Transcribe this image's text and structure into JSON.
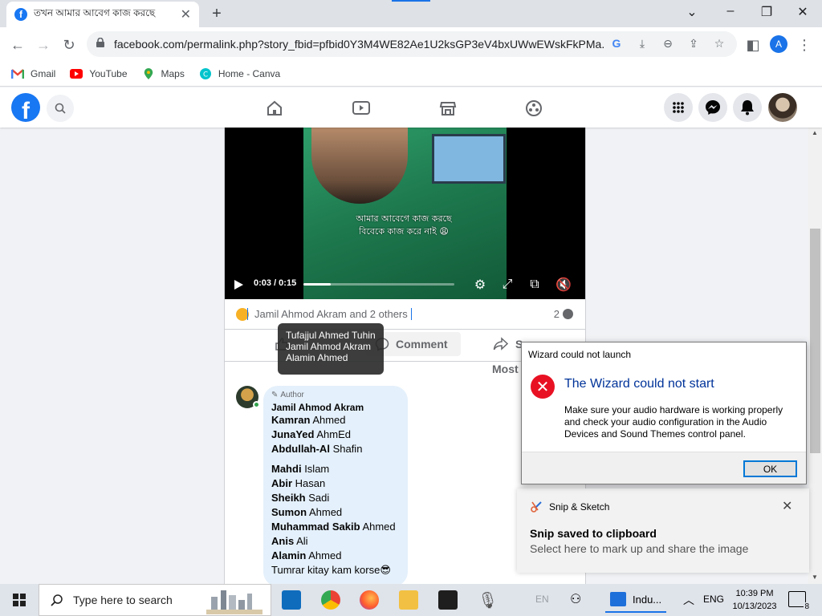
{
  "browser": {
    "tab_title": "তখন আমার আবেগ কাজ করছে",
    "url": "facebook.com/permalink.php?story_fbid=pfbid0Y3M4WE82Ae1U2ksGP3eV4bxUWwEWskFkPMa...",
    "profile_letter": "A",
    "bookmarks": [
      {
        "label": "Gmail",
        "icon": "gmail-icon"
      },
      {
        "label": "YouTube",
        "icon": "youtube-icon"
      },
      {
        "label": "Maps",
        "icon": "maps-icon"
      },
      {
        "label": "Home - Canva",
        "icon": "canva-icon"
      }
    ]
  },
  "video": {
    "caption_line1": "আমার আবেগে কাজ করছে",
    "caption_line2": "বিবেকে কাজ করে নাই 😩",
    "time": "0:03 / 0:15",
    "progress": 0.18
  },
  "reactions": {
    "names": "Jamil Ahmod Akram and 2 others",
    "comment_count": "2"
  },
  "actions": {
    "comment": "Comment",
    "share": "S",
    "sort": "Most"
  },
  "tooltip": {
    "lines": [
      "Tufajjul Ahmed Tuhin",
      "Jamil Ahmod Akram",
      "Alamin Ahmed"
    ]
  },
  "comment": {
    "badge": "Author",
    "author": "Jamil Ahmod Akram",
    "lines_a": [
      {
        "first": "Kamran",
        "last": "Ahmed"
      },
      {
        "first": "JunaYed",
        "last": "AhmEd"
      },
      {
        "first": "Abdullah-Al",
        "last": "Shafin"
      }
    ],
    "lines_b": [
      {
        "first": "Mahdi",
        "last": "Islam"
      },
      {
        "first": "Abir",
        "last": "Hasan"
      },
      {
        "first": "Sheikh",
        "last": "Sadi"
      },
      {
        "first": "Sumon",
        "last": "Ahmed"
      },
      {
        "first": "Muhammad Sakib",
        "last": "Ahmed"
      },
      {
        "first": "Anis",
        "last": "Ali"
      },
      {
        "first": "Alamin",
        "last": "Ahmed"
      }
    ],
    "last_line": "Tumrar kitay kam korse😎"
  },
  "dialog": {
    "title": "Wizard could not launch",
    "heading": "The Wizard could not start",
    "message": "Make sure your audio hardware is working properly and check your audio configuration in the Audio Devices and Sound Themes control panel.",
    "ok": "OK"
  },
  "toast": {
    "app": "Snip & Sketch",
    "heading": "Snip saved to clipboard",
    "body": "Select here to mark up and share the image"
  },
  "taskbar": {
    "search_placeholder": "Type here to search",
    "app_label": "Indu...",
    "lang_faded": "EN",
    "lang": "ENG",
    "time": "10:39 PM",
    "date": "10/13/2023",
    "notifications": "8"
  },
  "colors": {
    "facebook_blue": "#1877f2",
    "error_red": "#e81123",
    "dialog_heading": "#003399"
  }
}
